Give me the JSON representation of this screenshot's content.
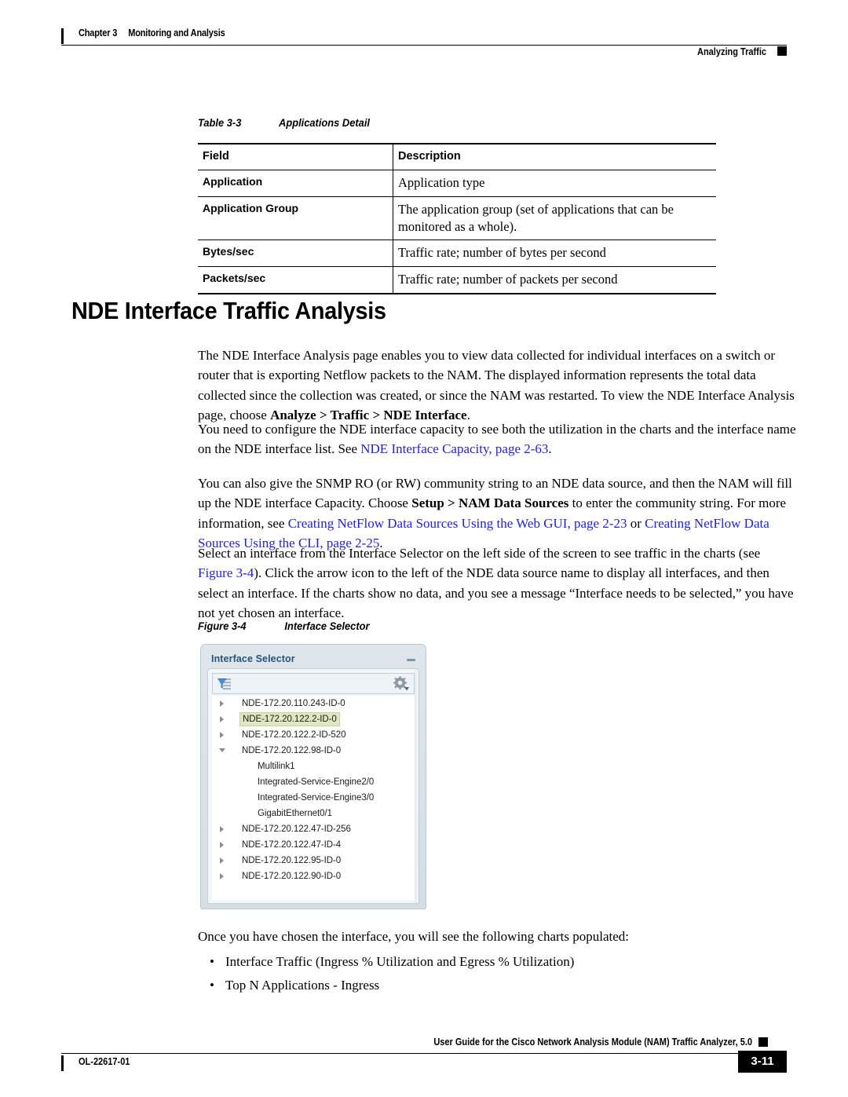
{
  "header": {
    "chapter": "Chapter 3",
    "chapter_title": "Monitoring and Analysis",
    "running_head": "Analyzing Traffic"
  },
  "table_caption": {
    "label": "Table",
    "number": "3-3",
    "title": "Applications Detail"
  },
  "table": {
    "columns": [
      "Field",
      "Description"
    ],
    "rows": [
      [
        "Application",
        "Application type"
      ],
      [
        "Application Group",
        "The application group (set of applications that can be monitored as a whole)."
      ],
      [
        "Bytes/sec",
        "Traffic rate; number of bytes per second"
      ],
      [
        "Packets/sec",
        "Traffic rate; number of packets per second"
      ]
    ]
  },
  "section": {
    "title": "NDE Interface Traffic Analysis",
    "paragraph_1_a": "The NDE Interface Analysis page enables you to view data collected for individual interfaces on a switch or router that is exporting Netflow packets to the NAM. The displayed information represents the total data collected since the collection was created, or since the NAM was restarted. To view the NDE Interface Analysis page, choose ",
    "paragraph_1_bold": "Analyze > Traffic > NDE Interface",
    "paragraph_1_b": ".",
    "paragraph_2_a": "You need to configure the NDE interface capacity to see both the utilization in the charts and the interface name on the NDE interface list. See ",
    "paragraph_2_link": "NDE Interface Capacity, page 2-63",
    "paragraph_2_b": ".",
    "paragraph_3_a": "You can also give the SNMP RO (or RW) community string to an NDE data source, and then the NAM will fill up the NDE interface Capacity. Choose ",
    "paragraph_3_bold": "Setup > NAM Data Sources",
    "paragraph_3_b": " to enter the community string. For more information, see ",
    "paragraph_3_link1": "Creating NetFlow Data Sources Using the Web GUI, page 2-23",
    "paragraph_3_c": " or ",
    "paragraph_3_link2": "Creating NetFlow Data Sources Using the CLI, page 2-25",
    "paragraph_3_d": ".",
    "paragraph_4_a": "Select an interface from the Interface Selector on the left side of the screen to see traffic in the charts (see ",
    "paragraph_4_link": "Figure 3-4",
    "paragraph_4_b": "). Click the arrow icon to the left of the NDE data source name to display all interfaces, and then select an interface. If the charts show no data, and you see a message “Interface needs to be selected,” you have not yet chosen an interface.",
    "paragraph_5": "Once you have chosen the interface, you will see the following charts populated:",
    "bullets": [
      "Interface Traffic (Ingress % Utilization and Egress % Utilization)",
      "Top N Applications - Ingress"
    ],
    "bullet_glyph": "•"
  },
  "figure_caption": {
    "label": "Figure",
    "number": "3-4",
    "title": "Interface Selector"
  },
  "screenshot": {
    "panel_title": "Interface Selector",
    "toolbar": {
      "filter_icon": "filter-icon",
      "gear_icon": "gear-icon"
    },
    "minimize_label": "—",
    "tree": [
      {
        "label": "NDE-172.20.110.243-ID-0",
        "level": 0,
        "expanded": false,
        "selected": false
      },
      {
        "label": "NDE-172.20.122.2-ID-0",
        "level": 0,
        "expanded": false,
        "selected": true
      },
      {
        "label": "NDE-172.20.122.2-ID-520",
        "level": 0,
        "expanded": false,
        "selected": false
      },
      {
        "label": "NDE-172.20.122.98-ID-0",
        "level": 0,
        "expanded": true,
        "selected": false
      },
      {
        "label": "Multilink1",
        "level": 1,
        "expanded": null,
        "selected": false
      },
      {
        "label": "Integrated-Service-Engine2/0",
        "level": 1,
        "expanded": null,
        "selected": false
      },
      {
        "label": "Integrated-Service-Engine3/0",
        "level": 1,
        "expanded": null,
        "selected": false
      },
      {
        "label": "GigabitEthernet0/1",
        "level": 1,
        "expanded": null,
        "selected": false
      },
      {
        "label": "NDE-172.20.122.47-ID-256",
        "level": 0,
        "expanded": false,
        "selected": false
      },
      {
        "label": "NDE-172.20.122.47-ID-4",
        "level": 0,
        "expanded": false,
        "selected": false
      },
      {
        "label": "NDE-172.20.122.95-ID-0",
        "level": 0,
        "expanded": false,
        "selected": false
      },
      {
        "label": "NDE-172.20.122.90-ID-0",
        "level": 0,
        "expanded": false,
        "selected": false
      }
    ],
    "colors": {
      "panel_title_color": "#23557e",
      "selected_row_bg": "#dde8c1",
      "panel_bg": "#dfe7ec"
    }
  },
  "footer": {
    "book_title": "User Guide for the Cisco Network Analysis Module (NAM) Traffic Analyzer, 5.0",
    "doc_id": "OL-22617-01",
    "page_number": "3-11"
  }
}
